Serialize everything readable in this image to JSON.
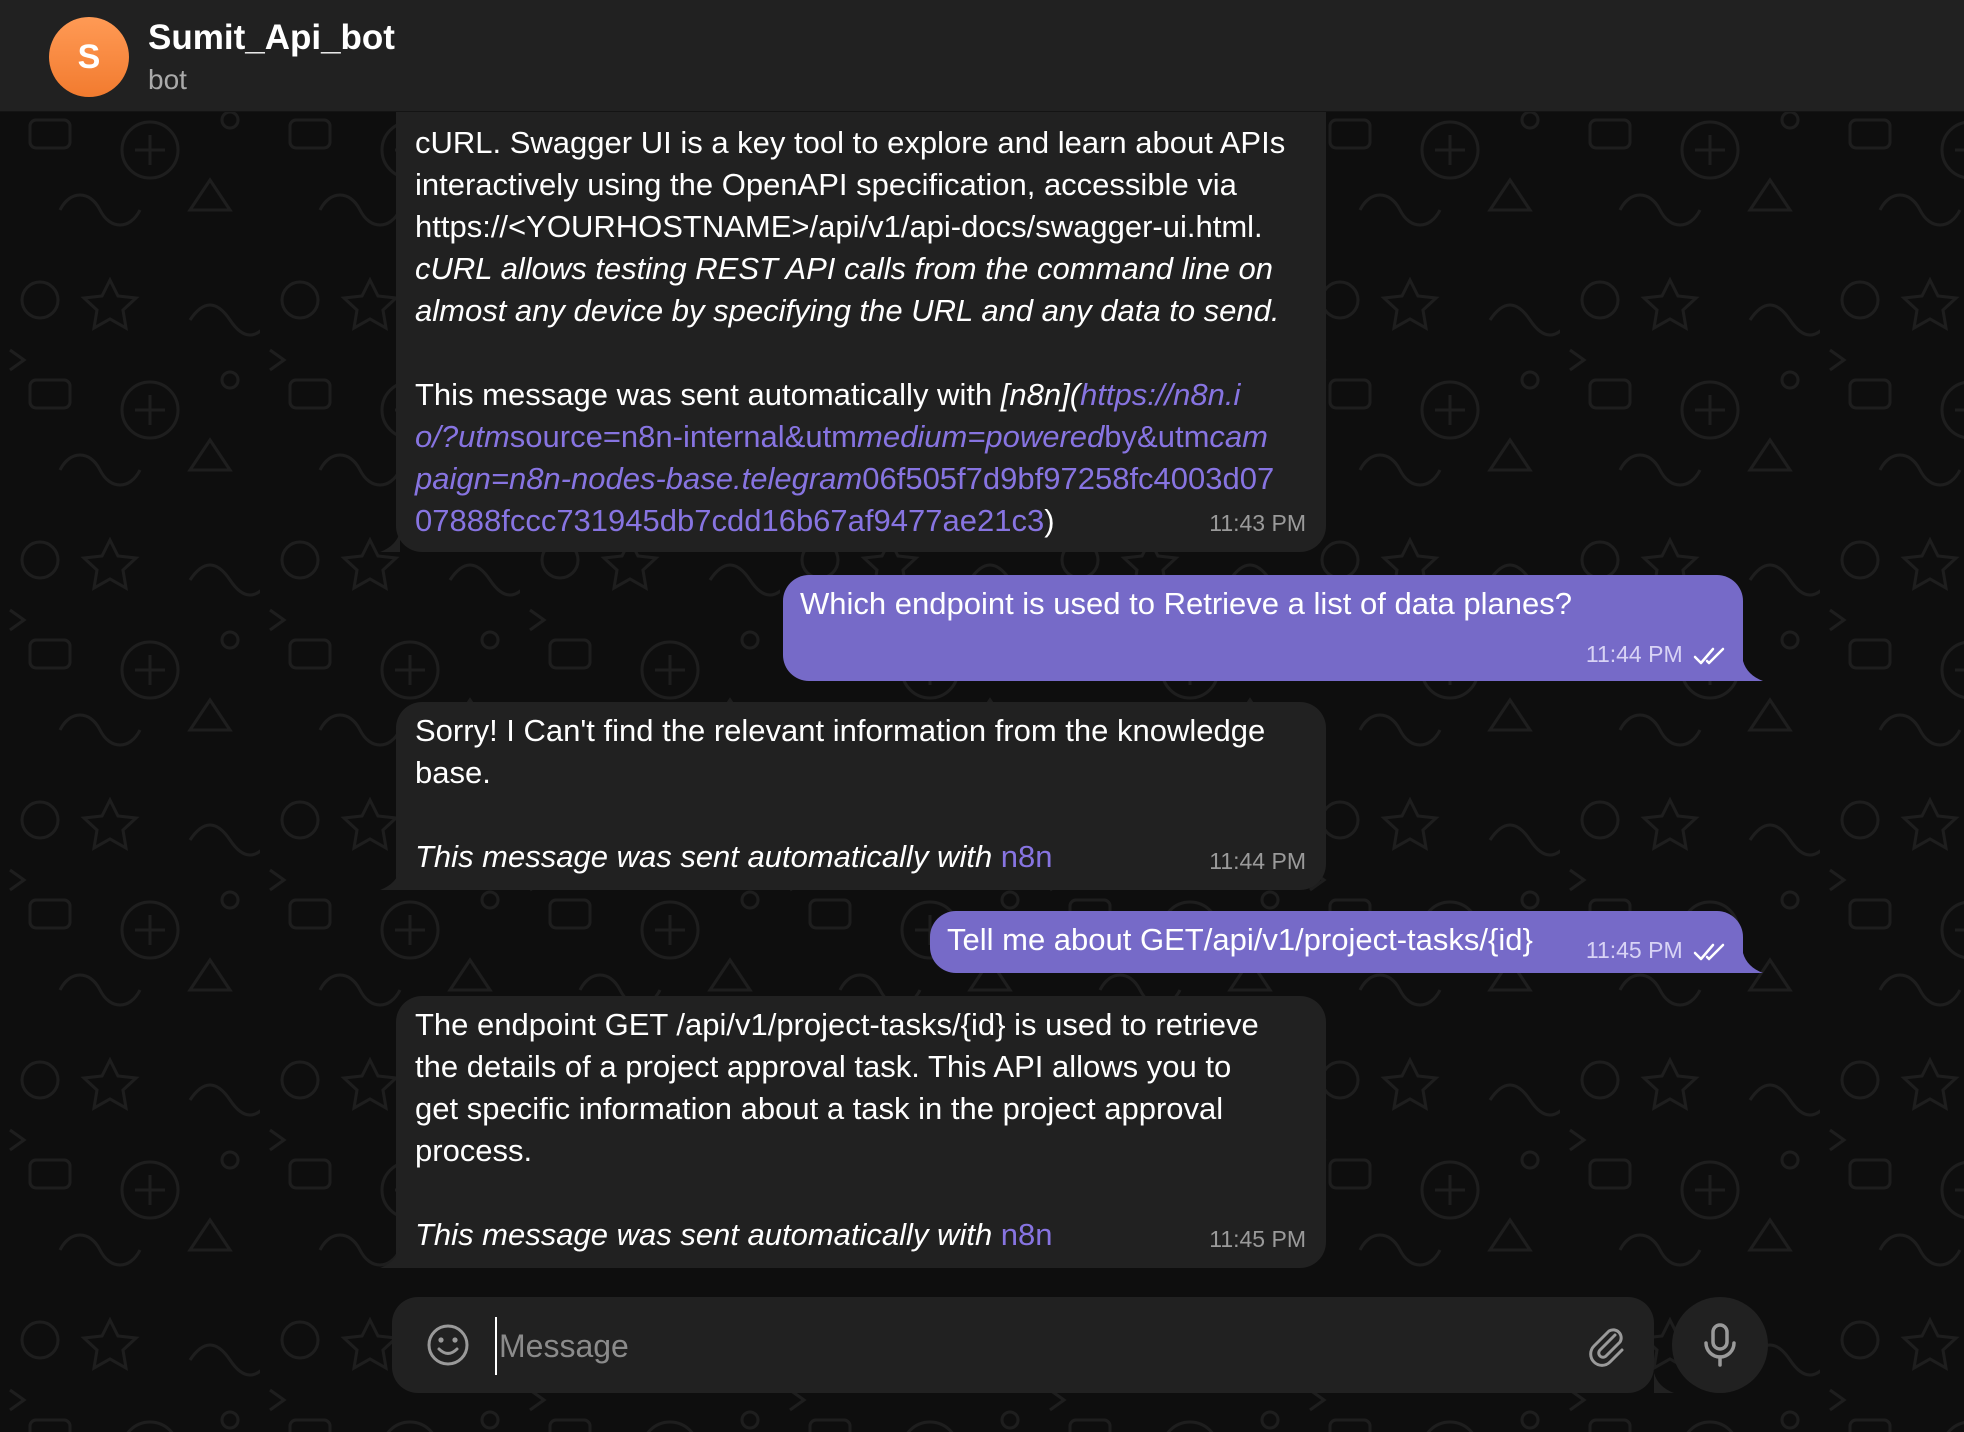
{
  "header": {
    "avatar_letter": "S",
    "title": "Sumit_Api_bot",
    "subtitle": "bot"
  },
  "colors": {
    "background": "#0e0e0e",
    "header": "#212121",
    "incoming_bubble": "#212121",
    "outgoing_bubble": "#766ac8",
    "link": "#8774e1",
    "avatar": "#f27b2f"
  },
  "messages": [
    {
      "direction": "incoming",
      "lines": [
        "cURL. Swagger UI is a key tool to explore and learn about APIs",
        "interactively using the OpenAPI specification, accessible via",
        "https://<YOURHOSTNAME>/api/v1/api-docs/swagger-ui.html.",
        "cURL allows testing REST API calls from the command line on",
        "almost any device by specifying the URL and any data to send."
      ],
      "footer_prefix": "This message was sent automatically with ",
      "footer_md": "[n8n](",
      "footer_link_1": "https://n8n.i",
      "footer_link_2": "o/?utm",
      "footer_link_3": "source=n8n-internal&utm",
      "footer_link_4": "medium=powered",
      "footer_link_5": "by&utm",
      "footer_link_6": "cam",
      "footer_link_7": "paign=n8n-nodes-base.telegram",
      "footer_link_8": "06f505f7d9bf97258fc4003d07",
      "footer_link_9": "07888fccc731945db7cdd16b67af9477ae21c3",
      "footer_close": ")",
      "time": "11:43 PM"
    },
    {
      "direction": "outgoing",
      "text": "Which endpoint is used to Retrieve a list of data planes?",
      "time": "11:44 PM"
    },
    {
      "direction": "incoming",
      "lines": [
        "Sorry! I Can't find the relevant information from the knowledge",
        "base."
      ],
      "footer_prefix": "This message was sent automatically with ",
      "footer_link": "n8n",
      "time": "11:44 PM"
    },
    {
      "direction": "outgoing",
      "text": "Tell me about GET/api/v1/project-tasks/{id}",
      "time": "11:45 PM"
    },
    {
      "direction": "incoming",
      "lines": [
        "The endpoint GET /api/v1/project-tasks/{id} is used to retrieve",
        "the details of a project approval task. This API allows you to",
        "get specific information about a task in the project approval",
        "process."
      ],
      "footer_prefix": "This message was sent automatically with ",
      "footer_link": "n8n",
      "time": "11:45 PM"
    }
  ],
  "composer": {
    "placeholder": "Message",
    "emoji_icon": "smiley-icon",
    "attach_icon": "paperclip-icon",
    "mic_icon": "microphone-icon"
  }
}
